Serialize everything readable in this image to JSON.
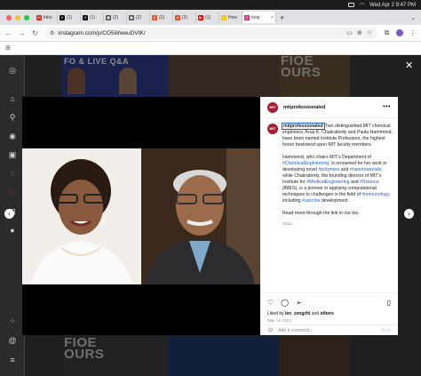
{
  "menubar": {
    "clock": "Wed Apr 2  9:47 PM"
  },
  "tabs": [
    {
      "label": "Inbo",
      "fav_color": "#d93025",
      "fav_glyph": "M"
    },
    {
      "label": "(1)",
      "fav_color": "#111111",
      "fav_glyph": "X"
    },
    {
      "label": "(1)",
      "fav_color": "#111111",
      "fav_glyph": "X"
    },
    {
      "label": "(2)",
      "fav_color": "#555555",
      "fav_glyph": "▣"
    },
    {
      "label": "(2)",
      "fav_color": "#555555",
      "fav_glyph": "▣"
    },
    {
      "label": "(2)",
      "fav_color": "#e8522d",
      "fav_glyph": "A"
    },
    {
      "label": "(2)",
      "fav_color": "#e8522d",
      "fav_glyph": "A"
    },
    {
      "label": "(1)",
      "fav_color": "#ff0000",
      "fav_glyph": "▶"
    },
    {
      "label": "How",
      "fav_color": "#f5c518",
      "fav_glyph": "+"
    },
    {
      "label": "Insp",
      "fav_color": "#d62976",
      "fav_glyph": "◎",
      "active": true
    }
  ],
  "address": {
    "url": "instagram.com/p/CO5WweuDVtK/"
  },
  "background": {
    "banner_text": "FO & LIVE Q&A",
    "tile_text_1": "FIOE\nOURS",
    "tile_text_2": "FIOE\nOURS"
  },
  "post": {
    "username": "mitprofessionaled",
    "logo_text": "MIT",
    "caption_user": "mitprofessionaled",
    "caption_p1": "Two distinguished MIT chemical engineers, Arup K. Chakraborty and Paula Hammond, have been named Institute Professors, the highest honor bestowed upon MIT faculty members.",
    "caption_p2_a": "Hammond, who chairs MIT's Department of ",
    "tag_chem": "#ChemicalEngineering",
    "caption_p2_b": ", is renowned for her work in developing novel ",
    "tag_polymers": "#polymers",
    "caption_p2_c": " and ",
    "tag_nano": "#nanomaterials",
    "caption_p2_d": ", while Chakraborty, the founding director of MIT's Institute for ",
    "tag_medeng": "#MedicalEngineering",
    "caption_p2_e": " and ",
    "tag_science": "#Science",
    "caption_p2_f": " (IMES), is a pioneer in applying computational techniques to challenges in the field of ",
    "tag_immuno": "#immunology",
    "caption_p2_g": ", including ",
    "tag_vaccine": "#vaccine",
    "caption_p2_h": " development.",
    "caption_p3": "Read more through the link in our bio.",
    "caption_age": "202w",
    "likes_prefix": "Liked by ",
    "likes_user": "leo_zengzhi",
    "likes_mid": " and ",
    "likes_others": "others",
    "date": "May 16, 2021",
    "comment_placeholder": "Add a comment...",
    "post_label": "Post"
  },
  "colors": {
    "mit_red": "#a31f34",
    "link_blue": "#1a5fd6"
  },
  "icons": [
    "instagram-icon",
    "home-icon",
    "search-icon",
    "explore-icon",
    "reels-icon",
    "messages-icon",
    "notifications-icon",
    "create-icon",
    "threads-icon",
    "menu-icon"
  ]
}
